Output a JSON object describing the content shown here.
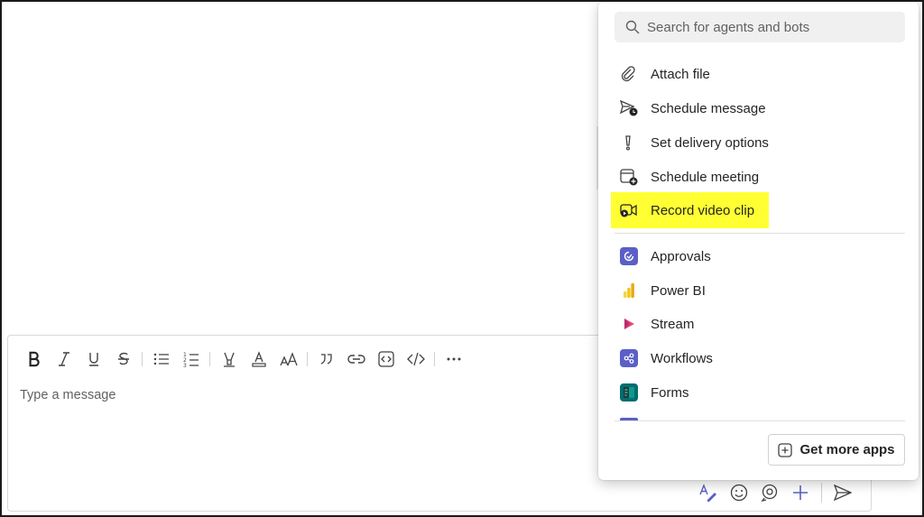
{
  "compose": {
    "placeholder": "Type a message",
    "format_tools": [
      "bold",
      "italic",
      "underline",
      "strikethrough",
      "bulleted-list",
      "numbered-list",
      "highlight",
      "font-color",
      "font-size",
      "quote",
      "link",
      "code-snippet",
      "code",
      "more-options"
    ]
  },
  "menu": {
    "search_placeholder": "Search for agents and bots",
    "actions": [
      {
        "label": "Attach file",
        "icon": "paperclip-icon"
      },
      {
        "label": "Schedule message",
        "icon": "schedule-send-icon"
      },
      {
        "label": "Set delivery options",
        "icon": "exclamation-icon"
      },
      {
        "label": "Schedule meeting",
        "icon": "calendar-add-icon"
      },
      {
        "label": "Record video clip",
        "icon": "video-clip-icon",
        "highlighted": true
      }
    ],
    "apps": [
      {
        "label": "Approvals",
        "icon": "approvals-icon",
        "color": "#5b5fc7"
      },
      {
        "label": "Power BI",
        "icon": "power-bi-icon",
        "color": "#f2c811"
      },
      {
        "label": "Stream",
        "icon": "stream-icon",
        "color": "#e8467c"
      },
      {
        "label": "Workflows",
        "icon": "workflows-icon",
        "color": "#5b5fc7"
      },
      {
        "label": "Forms",
        "icon": "forms-icon",
        "color": "#036c70"
      }
    ],
    "get_more_apps": "Get more apps"
  },
  "colors": {
    "highlight": "#ffff33",
    "accent": "#5b5fc7"
  }
}
